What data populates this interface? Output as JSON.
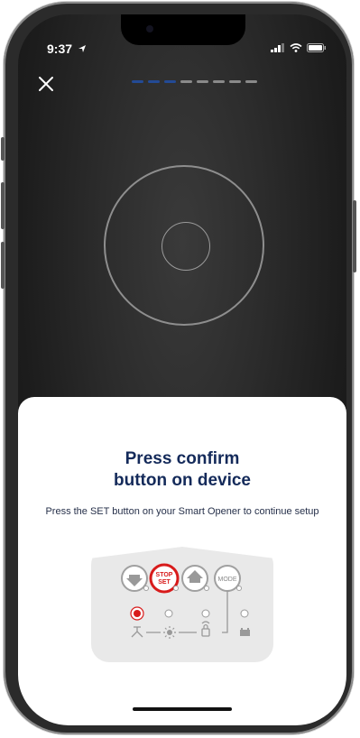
{
  "status_bar": {
    "time": "9:37"
  },
  "progress": {
    "total_steps": 8,
    "completed_steps": 3
  },
  "sheet": {
    "title": "Press confirm\nbutton on device",
    "subtitle": "Press the SET button on your Smart Opener to continue setup"
  },
  "device": {
    "stop_label": "STOP",
    "set_label": "SET",
    "mode_label": "MODE"
  },
  "colors": {
    "accent": "#234a95",
    "title": "#142a5a",
    "highlight": "#d81b1b"
  },
  "icons": [
    "close-icon",
    "location-arrow-icon",
    "signal-icon",
    "wifi-icon",
    "battery-icon",
    "down-arrow-icon",
    "up-arrow-icon",
    "motion-sensor-icon",
    "light-icon",
    "lock-icon",
    "battery-indicator-icon"
  ]
}
